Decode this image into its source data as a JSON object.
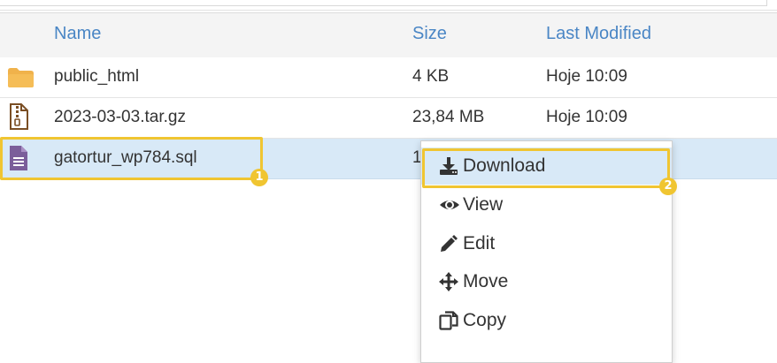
{
  "table": {
    "headers": {
      "name": "Name",
      "size": "Size",
      "modified": "Last Modified"
    },
    "rows": [
      {
        "name": "public_html",
        "size": "4 KB",
        "modified": "Hoje 10:09",
        "icon": "folder-icon"
      },
      {
        "name": "2023-03-03.tar.gz",
        "size": "23,84 MB",
        "modified": "Hoje 10:09",
        "icon": "archive-file-icon"
      },
      {
        "name": "gatortur_wp784.sql",
        "size": "1",
        "modified": "",
        "icon": "text-file-icon"
      }
    ]
  },
  "context_menu": {
    "items": [
      {
        "label": "Download",
        "icon": "download-icon"
      },
      {
        "label": "View",
        "icon": "eye-icon"
      },
      {
        "label": "Edit",
        "icon": "pencil-icon"
      },
      {
        "label": "Move",
        "icon": "move-arrows-icon"
      },
      {
        "label": "Copy",
        "icon": "copy-icon"
      }
    ]
  },
  "annotations": {
    "step1": "1",
    "step2": "2"
  },
  "colors": {
    "accent": "#4a86c5",
    "highlight": "#f0c531",
    "selected_row": "#d8e9f7",
    "folder": "#f0b24b",
    "archive": "#7a4e24",
    "text_file": "#7b5e9a"
  }
}
